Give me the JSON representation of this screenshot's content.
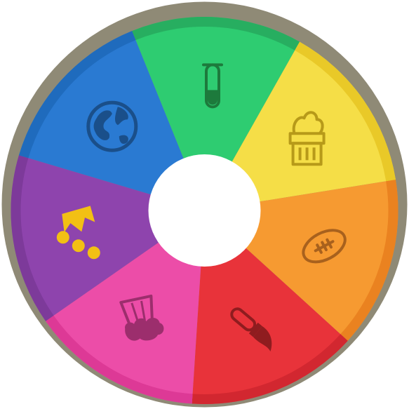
{
  "wheel": {
    "rim_color": "#8f8a76",
    "hub_color": "#ffffff",
    "segments": [
      {
        "category": "science",
        "color": "#2ecc71",
        "shade": "#27ae60",
        "icon": "test-tube-icon",
        "icon_color": "#1d7a3c",
        "selected": false
      },
      {
        "category": "history",
        "color": "#f5de47",
        "shade": "#e9c928",
        "icon": "castle-tower-icon",
        "icon_color": "#b79a19",
        "selected": false
      },
      {
        "category": "sports",
        "color": "#f69a31",
        "shade": "#ea8220",
        "icon": "football-icon",
        "icon_color": "#a8611d",
        "selected": false
      },
      {
        "category": "art",
        "color": "#e8333a",
        "shade": "#d22730",
        "icon": "paintbrush-icon",
        "icon_color": "#8f1c1f",
        "selected": false
      },
      {
        "category": "entertainment",
        "color": "#ec4da8",
        "shade": "#dd3996",
        "icon": "popcorn-bucket-icon",
        "icon_color": "#9c2e6d",
        "selected": false
      },
      {
        "category": "crown",
        "color": "#8e44ad",
        "shade": "#7d3a9a",
        "icon": "crown-icon",
        "icon_color": "#f2c014",
        "selected": true
      },
      {
        "category": "geography",
        "color": "#2a7ad2",
        "shade": "#1f6bbd",
        "icon": "globe-icon",
        "icon_color": "#1a4f8a",
        "selected": false
      }
    ]
  }
}
